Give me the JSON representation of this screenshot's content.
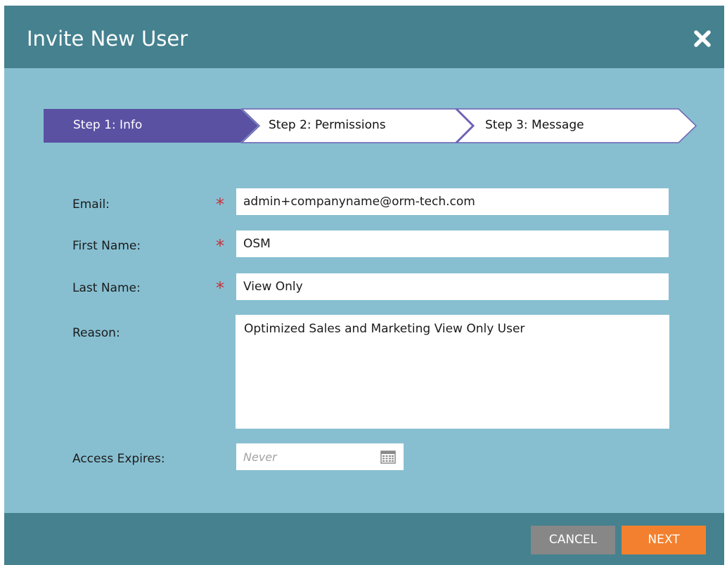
{
  "dialog": {
    "title": "Invite New User",
    "close_icon": "close-icon"
  },
  "steps": [
    {
      "label": "Step 1: Info",
      "active": true
    },
    {
      "label": "Step 2: Permissions",
      "active": false
    },
    {
      "label": "Step 3: Message",
      "active": false
    }
  ],
  "form": {
    "email": {
      "label": "Email:",
      "value": "admin+companyname@orm-tech.com",
      "required_mark": "*"
    },
    "first_name": {
      "label": "First Name:",
      "value": "OSM",
      "required_mark": "*"
    },
    "last_name": {
      "label": "Last Name:",
      "value": "View Only",
      "required_mark": "*"
    },
    "reason": {
      "label": "Reason:",
      "value": "Optimized Sales and Marketing View Only User"
    },
    "access_expires": {
      "label": "Access Expires:",
      "placeholder": "Never",
      "icon": "calendar-icon"
    }
  },
  "footer": {
    "cancel_label": "CANCEL",
    "next_label": "NEXT"
  },
  "colors": {
    "header": "#45818f",
    "body": "#87bfd1",
    "active_step": "#5b51a3",
    "required": "#c8313a",
    "cancel": "#878787",
    "next": "#f3802e"
  }
}
